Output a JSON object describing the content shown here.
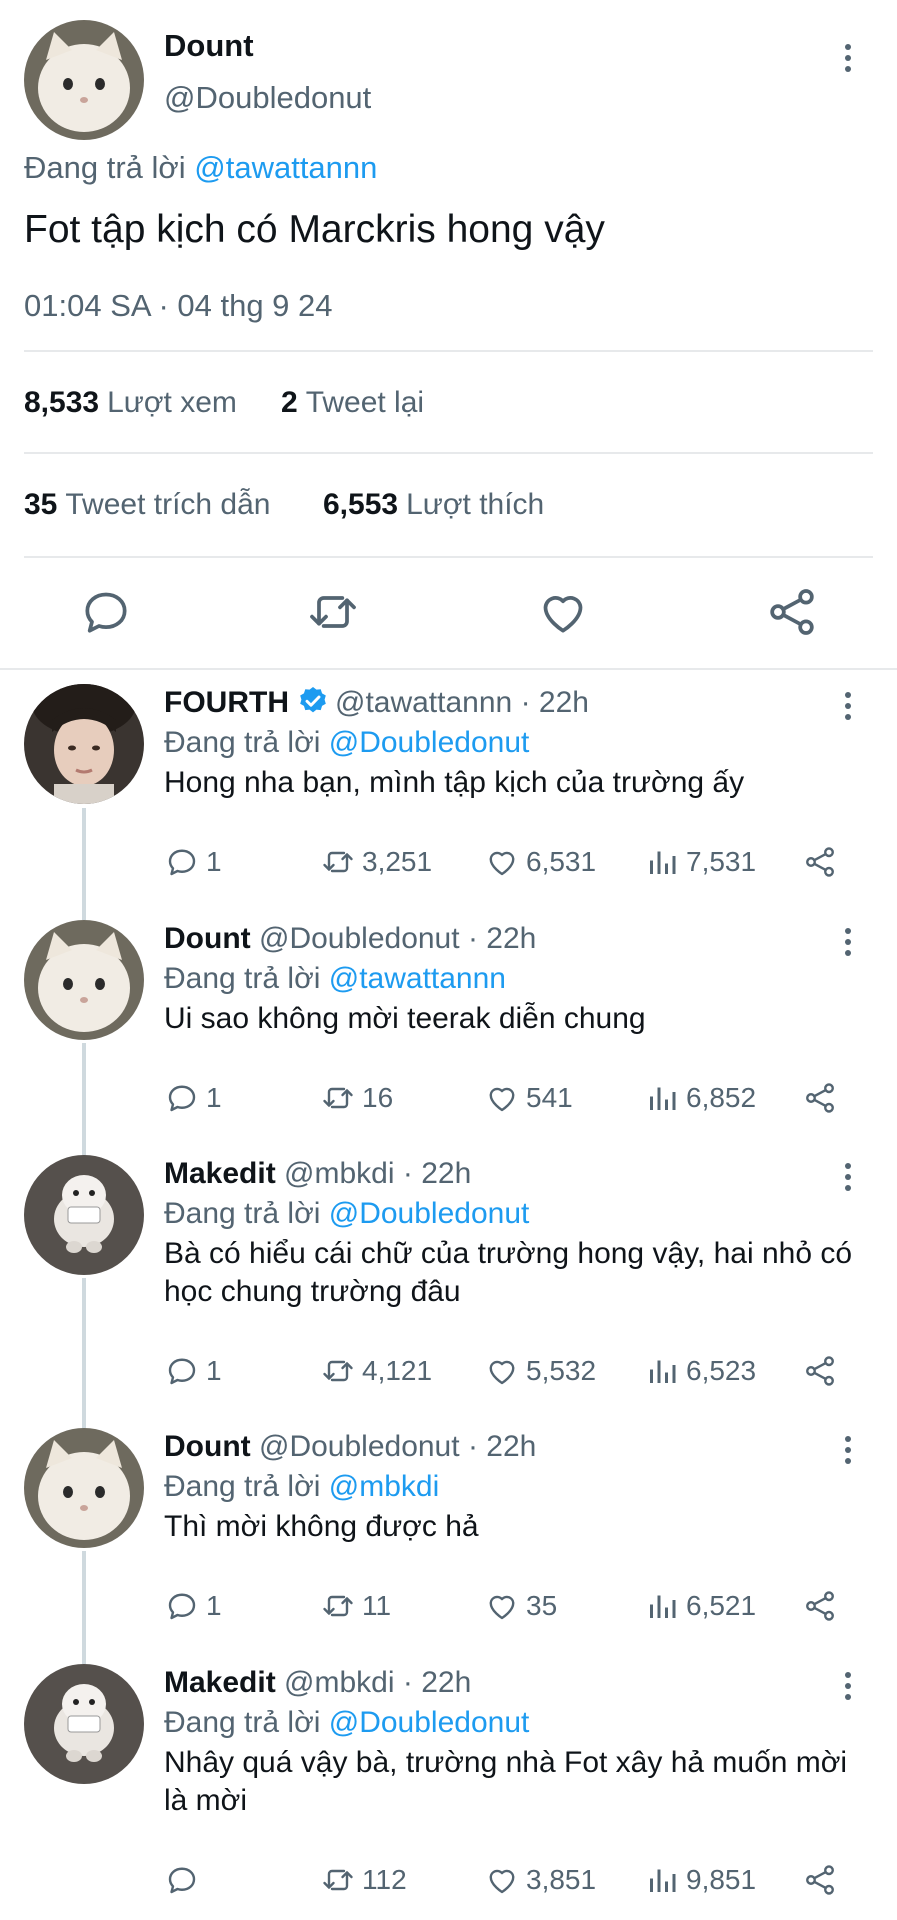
{
  "main_tweet": {
    "display_name": "Dount",
    "handle": "@Doubledonut",
    "replying_prefix": "Đang trả lời",
    "replying_to": "@tawattannn",
    "text": "Fot tập kịch có Marckris hong vậy",
    "timestamp": "01:04 SA · 04 thg 9 24",
    "stats": {
      "views_count": "8,533",
      "views_label": "Lượt xem",
      "retweets_count": "2",
      "retweets_label": "Tweet lại",
      "quotes_count": "35",
      "quotes_label": "Tweet trích dẫn",
      "likes_count": "6,553",
      "likes_label": "Lượt thích"
    },
    "icons": [
      "reply-icon",
      "retweet-icon",
      "like-icon",
      "share-icon"
    ]
  },
  "replies": [
    {
      "display_name": "FOURTH",
      "verified": true,
      "handle": "@tawattannn",
      "time": "· 22h",
      "replying_prefix": "Đang trả lời",
      "replying_to": "@Doubledonut",
      "text": "Hong nha bạn, mình tập kịch của trường ấy",
      "reply_count": "1",
      "retweet_count": "3,251",
      "like_count": "6,531",
      "view_count": "7,531"
    },
    {
      "display_name": "Dount",
      "verified": false,
      "handle": "@Doubledonut",
      "time": "· 22h",
      "replying_prefix": "Đang trả lời",
      "replying_to": "@tawattannn",
      "text": "Ui sao không mời teerak diễn chung",
      "reply_count": "1",
      "retweet_count": "16",
      "like_count": "541",
      "view_count": "6,852"
    },
    {
      "display_name": "Makedit",
      "verified": false,
      "handle": "@mbkdi",
      "time": "· 22h",
      "replying_prefix": "Đang trả lời",
      "replying_to": "@Doubledonut",
      "text": "Bà có hiểu cái chữ của trường hong vậy, hai nhỏ có học chung trường đâu",
      "reply_count": "1",
      "retweet_count": "4,121",
      "like_count": "5,532",
      "view_count": "6,523"
    },
    {
      "display_name": "Dount",
      "verified": false,
      "handle": "@Doubledonut",
      "time": "· 22h",
      "replying_prefix": "Đang trả lời",
      "replying_to": "@mbkdi",
      "text": "Thì mời không được hả",
      "reply_count": "1",
      "retweet_count": "11",
      "like_count": "35",
      "view_count": "6,521"
    },
    {
      "display_name": "Makedit",
      "verified": false,
      "handle": "@mbkdi",
      "time": "· 22h",
      "replying_prefix": "Đang trả lời",
      "replying_to": "@Doubledonut",
      "text": "Nhây quá vậy bà, trường nhà Fot xây hả muốn mời là mời",
      "reply_count": "",
      "retweet_count": "112",
      "like_count": "3,851",
      "view_count": "9,851"
    }
  ],
  "colors": {
    "accent": "#1d9bf0",
    "text": "#0f1419",
    "secondary": "#536471",
    "divider": "#e7e9eb"
  }
}
